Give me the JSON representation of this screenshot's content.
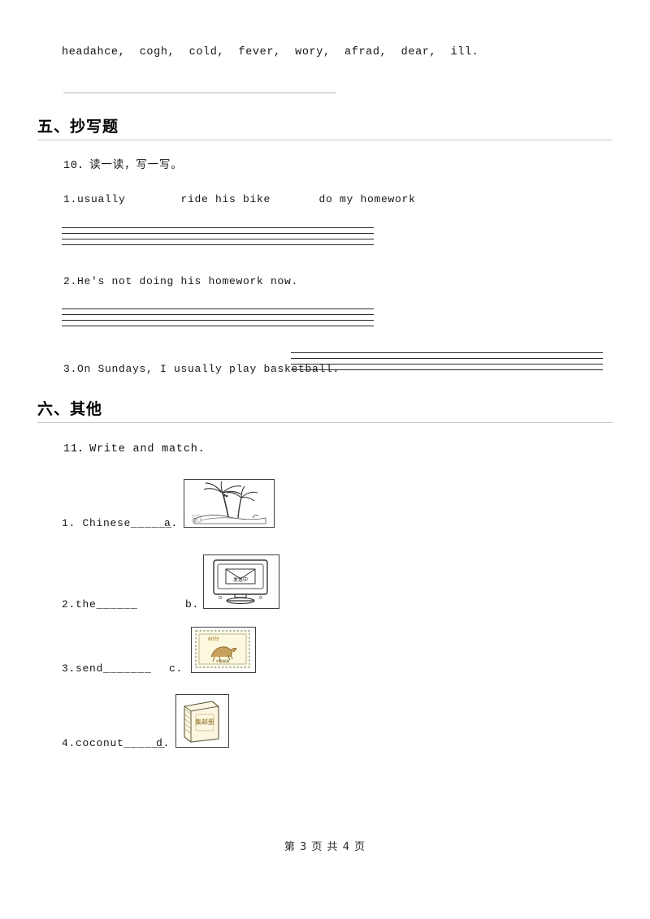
{
  "document": {
    "vocabulary_line": "headahce,  cogh,  cold,  fever,  wory,  afrad,  dear,  ill.",
    "sections": [
      {
        "heading": "五、抄写题",
        "questions": [
          {
            "number_label": "10．读一读，写一写。",
            "items": [
              "1.usually        ride his bike       do my homework",
              "2.He's not doing his homework now.",
              "3.On Sundays, I usually play basketball."
            ]
          }
        ]
      },
      {
        "heading": "六、其他",
        "questions": [
          {
            "number_label": "11．Write and match.",
            "items": [
              {
                "text": "1. Chinese______",
                "letter": "a.",
                "picture": "palm-tree-island"
              },
              {
                "text": "2.the______",
                "letter": "b.",
                "picture": "computer-sending-mail"
              },
              {
                "text": "3.send_______",
                "letter": "c.",
                "picture": "postage-stamp-60"
              },
              {
                "text": "4.coconut______",
                "letter": "d.",
                "picture": "stamp-album-book"
              }
            ]
          }
        ]
      }
    ],
    "pictures": {
      "stamp_value": "60分",
      "stamp_caption": "中国邮政",
      "album_title": "集邮册",
      "screen_text": "发送中"
    },
    "footer": {
      "prefix": "第",
      "current_page": "3",
      "middle": "页 共",
      "total_pages": "4",
      "suffix": "页"
    }
  }
}
